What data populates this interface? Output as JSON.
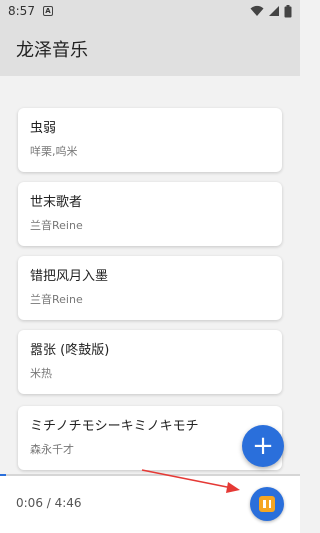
{
  "status_bar": {
    "time": "8:57",
    "notification_glyph": "A",
    "icons": [
      "wifi-icon",
      "signal-icon",
      "battery-icon"
    ]
  },
  "app_bar": {
    "title": "龙泽音乐"
  },
  "songs": [
    {
      "title": "虫弱",
      "artist": "咩栗,呜米"
    },
    {
      "title": "世末歌者",
      "artist": "兰音Reine"
    },
    {
      "title": "错把风月入墨",
      "artist": "兰音Reine"
    },
    {
      "title": "嚣张 (咚鼓版)",
      "artist": "米热"
    },
    {
      "title": "ミチノチモシーキミノキモチ",
      "artist": "森永千才"
    }
  ],
  "fab": {
    "icon": "plus-icon",
    "label": "+"
  },
  "player": {
    "time_display": "0:06 / 4:46",
    "progress_fraction": 0.021,
    "pause_icon": "pause-icon"
  },
  "colors": {
    "accent": "#2a6fdb",
    "bar_background": "#e0e0e0",
    "pause_inner": "#f5a623",
    "annotation_arrow": "#e53935"
  }
}
